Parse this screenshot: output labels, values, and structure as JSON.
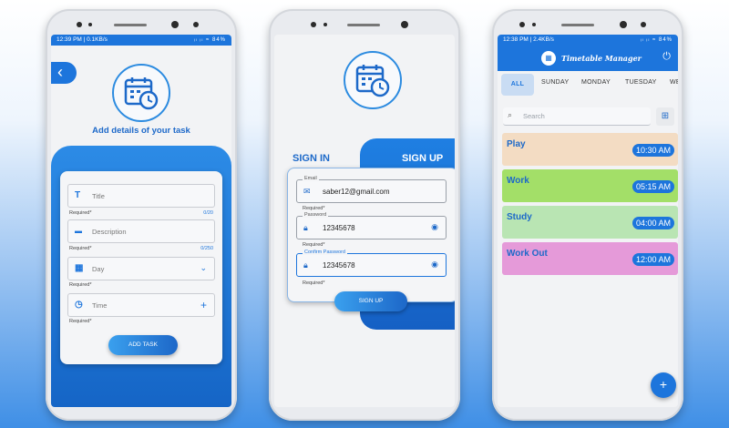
{
  "phone1": {
    "status_time": "12:39 PM | 0.1KB/s",
    "status_icons": "ᵢₗ ᵢₗ ≈ 84%",
    "title": "Add details of your task",
    "fields": [
      {
        "icon": "T",
        "placeholder": "Title",
        "required": "Required*",
        "counter": "0/20"
      },
      {
        "icon": "▬",
        "placeholder": "Description",
        "required": "Required*",
        "counter": "0/250"
      },
      {
        "icon": "▦",
        "placeholder": "Day",
        "required": "Required*",
        "counter": ""
      },
      {
        "icon": "◷",
        "placeholder": "Time",
        "required": "Required*",
        "counter": ""
      }
    ],
    "add_button": "ADD TASK"
  },
  "phone2": {
    "tab_signin": "SIGN IN",
    "tab_signup": "SIGN UP",
    "email_label": "Email",
    "email_value": "saber12@gmail.com",
    "password_label": "Password",
    "password_value": "12345678",
    "confirm_label": "Confirm Password",
    "confirm_value": "12345678",
    "required": "Required*",
    "signup_button": "SIGN UP"
  },
  "phone3": {
    "status_time": "12:38 PM | 2.4KB/s",
    "status_icons": "ᵢₗ ᵢₗ ≈ 84%",
    "app_title": "Timetable Manager",
    "days": [
      "ALL",
      "SUNDAY",
      "MONDAY",
      "TUESDAY",
      "WE"
    ],
    "search_placeholder": "Search",
    "tasks": [
      {
        "name": "Play",
        "time": "10:30 AM",
        "color": "#f3dcc3"
      },
      {
        "name": "Work",
        "time": "05:15 AM",
        "color": "#a3df68"
      },
      {
        "name": "Study",
        "time": "04:00 AM",
        "color": "#b9e5b3"
      },
      {
        "name": "Work Out",
        "time": "12:00 AM",
        "color": "#e59ad9"
      }
    ],
    "fab": "+"
  },
  "colors": {
    "accent": "#1d75dc",
    "title_blue": "#1d69c9"
  }
}
